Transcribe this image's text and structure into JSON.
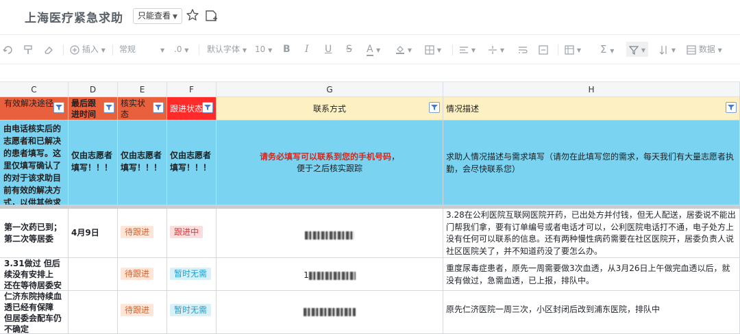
{
  "doc": {
    "title": "上海医疗紧急求助",
    "view_mode": "只能查看"
  },
  "toolbar": {
    "insert_label": "插入",
    "number_format": "常规",
    "decimal": ".0",
    "font_family": "默认字体",
    "font_size": "10",
    "data_label": "数据"
  },
  "columns": [
    "C",
    "D",
    "E",
    "F",
    "G",
    "H"
  ],
  "headers": {
    "c": "有效解决途径",
    "d": "最后跟进时间",
    "e": "核实状态",
    "f": "跟进状态",
    "g": "联系方式",
    "h": "情况描述"
  },
  "notes": {
    "c": "由电话核实后的志愿者和已解决的患者填写。这里仅填写确认了的对于该求助目前有效的解决方式，以供其他求",
    "d": "仅由志愿者填写！！！",
    "e": "仅由志愿者填写！！！",
    "f": "仅由志愿者填写！！！",
    "g_red": "请务必填写可以联系到您的手机号码",
    "g_comma": "，",
    "g_rest": "便于之后核实跟踪",
    "h": "求助人情况描述与需求填写（请勿在此填写您的需求，每天我们有大量志愿者执勤，会尽快联系您）"
  },
  "rows": [
    {
      "c": "第一次药已到；第二次等居委",
      "d": "4月9日",
      "e": "待跟进",
      "f": "跟进中",
      "g_visible": "",
      "h": "3.28在公利医院互联网医院开药，已出处方并付钱，但无人配送，居委说不能出门帮我们拿，要有订单编号或者电话才可以，公利医院电话打不通，电子处方上没有任何可以联系的信息。还有两种慢性病药需要在社区医院开，居委负责人说社区医院关了，并不知道药没了要怎么办。"
    },
    {
      "c": "3.31做过 但后续没有安排上 还在等待居委安排",
      "d": "",
      "e": "待跟进",
      "f": "暂时无需",
      "g_visible": "1",
      "h": "重度尿毒症患者，原先一周需要做3次血透，从3月26日上午做完血透以后，就没有做过，急需血透，已上报，排队中。"
    },
    {
      "c": "仁济东院持续血透已经有保障 但居委会配车仍不确定",
      "d": "",
      "e": "待跟进",
      "f": "暂时无需",
      "g_visible": "",
      "h": "原先仁济医院一周三次，小区封闭后改到浦东医院，排队中"
    }
  ],
  "colors": {
    "header_orange": "#e8603c",
    "header_red": "#ff2a2a",
    "header_yellow": "#fdf1c3",
    "note_blue": "#79d3f1"
  }
}
